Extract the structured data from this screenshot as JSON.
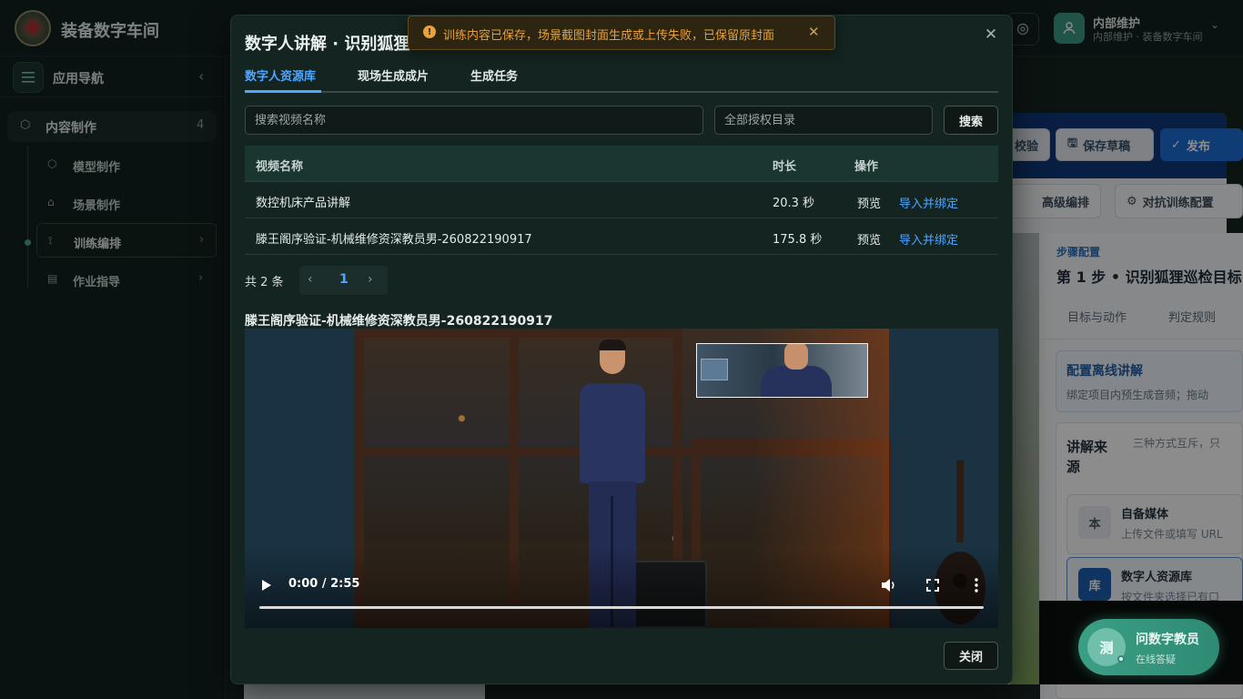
{
  "app": {
    "title": "装备数字车间"
  },
  "user": {
    "name": "内部维护",
    "subtitle": "内部维护 · 装备数字车间"
  },
  "sidebar": {
    "header": "应用导航",
    "group": {
      "label": "内容制作",
      "count": "4"
    },
    "items": [
      {
        "label": "模型制作",
        "icon": "cube-icon"
      },
      {
        "label": "场景制作",
        "icon": "building-icon"
      },
      {
        "label": "训练编排",
        "icon": "flow-icon"
      },
      {
        "label": "作业指导",
        "icon": "document-icon"
      }
    ]
  },
  "workspace": {
    "buttons": {
      "check": "校验",
      "save_draft": "保存草稿",
      "publish": "发布",
      "advanced_edit": "高级编排",
      "adversarial": "对抗训练配置"
    },
    "step": {
      "label": "步骤配置",
      "title": "第 1 步 • 识别狐狸巡检目标",
      "tabs": [
        "目标与动作",
        "判定规则"
      ]
    },
    "offline": {
      "title": "配置离线讲解",
      "desc": "绑定项目内预生成音频；拖动"
    },
    "source": {
      "title": "讲解来源",
      "hint": "三种方式互斥，只",
      "options": [
        {
          "icon": "本",
          "title": "自备媒体",
          "desc": "上传文件或填写 URL"
        },
        {
          "icon": "库",
          "title": "数字人资源库",
          "desc": "按文件夹选择已有口"
        }
      ]
    }
  },
  "assistant": {
    "avatar": "测",
    "title": "问数字教员",
    "subtitle": "在线答疑"
  },
  "modal": {
    "title": "数字人讲解 · 识别狐狸",
    "tabs": [
      "数字人资源库",
      "现场生成成片",
      "生成任务"
    ],
    "search": {
      "placeholder": "搜索视频名称",
      "catalog_placeholder": "全部授权目录",
      "button": "搜索"
    },
    "table": {
      "headers": [
        "视频名称",
        "时长",
        "操作"
      ],
      "rows": [
        {
          "name": "数控机床产品讲解",
          "duration": "20.3 秒",
          "preview": "预览",
          "action": "导入并绑定"
        },
        {
          "name": "滕王阁序验证-机械维修资深教员男-260822190917",
          "duration": "175.8 秒",
          "preview": "预览",
          "action": "导入并绑定"
        }
      ]
    },
    "pagination": {
      "total": "共 2 条",
      "current": "1"
    },
    "video": {
      "title": "滕王阁序验证-机械维修资深教员男-260822190917",
      "time": "0:00 / 2:55",
      "progress": 0
    },
    "close": "关闭"
  },
  "toast": {
    "message": "训练内容已保存，场景截图封面生成或上传失败，已保留原封面"
  },
  "colors": {
    "accent": "#4ea6ff",
    "warning": "#e6a23c",
    "brand_green": "#3d9a86"
  }
}
